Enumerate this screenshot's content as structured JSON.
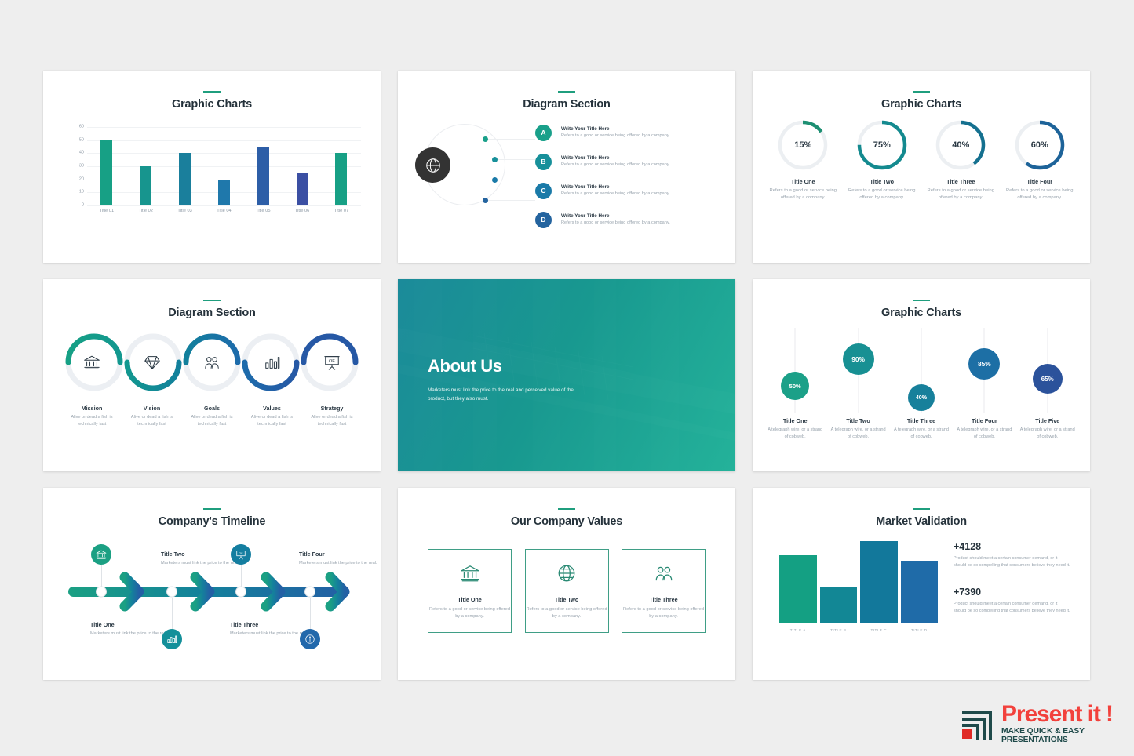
{
  "theme": {
    "accent_teal": "#1f9e7e",
    "accent_blue": "#2b5ea8",
    "title_color": "#25323b",
    "body_color": "#98a3ad"
  },
  "slides": {
    "bar_chart": {
      "title": "Graphic Charts",
      "chart_data": {
        "type": "bar",
        "title": "Graphic Charts",
        "xlabel": "",
        "ylabel": "",
        "ylim": [
          0,
          60
        ],
        "grid": true,
        "legend": "none",
        "categories": [
          "Title 01",
          "Title 02",
          "Title 03",
          "Title 04",
          "Title 05",
          "Title 06",
          "Title 07"
        ],
        "values": [
          50,
          30,
          40,
          19,
          45,
          25,
          40
        ],
        "yticks": [
          "60",
          "50",
          "40",
          "30",
          "20",
          "10",
          "0"
        ],
        "colors": [
          "#17a085",
          "#17958e",
          "#1a7f9c",
          "#1f78ab",
          "#2d5ea7",
          "#3b4fa3",
          "#17a085"
        ]
      }
    },
    "orbit_diagram": {
      "title": "Diagram Section",
      "center_icon": "globe-icon",
      "items": [
        {
          "badge": "A",
          "title": "Write Your Title Here",
          "desc": "Refers to a good or service being offered by a company.",
          "color": "#19a08a"
        },
        {
          "badge": "B",
          "title": "Write Your Title Here",
          "desc": "Refers to a good or service being offered by a company.",
          "color": "#17909a"
        },
        {
          "badge": "C",
          "title": "Write Your Title Here",
          "desc": "Refers to a good or service being offered by a company.",
          "color": "#1a7aa8"
        },
        {
          "badge": "D",
          "title": "Write Your Title Here",
          "desc": "Refers to a good or service being offered by a company.",
          "color": "#24649f"
        }
      ]
    },
    "donut_charts": {
      "title": "Graphic Charts",
      "chart_data": {
        "type": "pie",
        "title": "Graphic Charts",
        "legend": "below",
        "categories": [
          "Title One",
          "Title Two",
          "Title Three",
          "Title Four"
        ],
        "values": [
          15,
          75,
          40,
          60
        ],
        "unit": "%",
        "colors": [
          "#1d8f72",
          "#148a8f",
          "#14708f",
          "#1d6399"
        ]
      },
      "items": [
        {
          "percent": "15%",
          "title": "Title One",
          "desc": "Refers to a good or service being offered by a company."
        },
        {
          "percent": "75%",
          "title": "Title Two",
          "desc": "Refers to a good or service being offered by a company."
        },
        {
          "percent": "40%",
          "title": "Title Three",
          "desc": "Refers to a good or service being offered by a company."
        },
        {
          "percent": "60%",
          "title": "Title Four",
          "desc": "Refers to a good or service being offered by a company."
        }
      ]
    },
    "wave_diagram": {
      "title": "Diagram Section",
      "items": [
        {
          "icon": "bank-icon",
          "title": "Mission",
          "desc": "Alive or dead a fish is technically fast"
        },
        {
          "icon": "diamond-icon",
          "title": "Vision",
          "desc": "Alive or dead a fish is technically fast"
        },
        {
          "icon": "people-icon",
          "title": "Goals",
          "desc": "Alive or dead a fish is technically fast"
        },
        {
          "icon": "bar-chart-icon",
          "title": "Values",
          "desc": "Alive or dead a fish is technically fast"
        },
        {
          "icon": "presentation-icon",
          "title": "Strategy",
          "desc": "Alive or dead a fish is technically fast"
        }
      ]
    },
    "about_us": {
      "heading": "About Us",
      "paragraph": "Marketers must link the price to the real and perceived value of the product, but they also must."
    },
    "bubble_chart": {
      "title": "Graphic Charts",
      "chart_data": {
        "type": "scatter",
        "title": "Graphic Charts",
        "xlabel": "",
        "ylabel": "",
        "ylim": [
          0,
          100
        ],
        "categories": [
          "Title One",
          "Title Two",
          "Title Three",
          "Title Four",
          "Title Five"
        ],
        "values": [
          50,
          90,
          40,
          85,
          65
        ],
        "unit": "%",
        "colors": [
          "#1ba088",
          "#179093",
          "#17809b",
          "#1d6fa5",
          "#2b529b"
        ]
      },
      "items": [
        {
          "percent": "50%",
          "title": "Title One",
          "desc": "A telegraph wire, or a strand of cobweb."
        },
        {
          "percent": "90%",
          "title": "Title Two",
          "desc": "A telegraph wire, or a strand of cobweb."
        },
        {
          "percent": "40%",
          "title": "Title Three",
          "desc": "A telegraph wire, or a strand of cobweb."
        },
        {
          "percent": "85%",
          "title": "Title Four",
          "desc": "A telegraph wire, or a strand of cobweb."
        },
        {
          "percent": "65%",
          "title": "Title Five",
          "desc": "A telegraph wire, or a strand of cobweb."
        }
      ]
    },
    "timeline": {
      "title": "Company's Timeline",
      "items": [
        {
          "icon": "bank-icon",
          "title": "Title One",
          "desc": "Marketers must link the price to the real.",
          "position": "icon-above"
        },
        {
          "icon": "bar-chart-icon",
          "title": "Title Two",
          "desc": "Marketers must link the price to the real.",
          "position": "icon-below"
        },
        {
          "icon": "presentation-icon",
          "title": "Title Three",
          "desc": "Marketers must link the price to the real.",
          "position": "icon-above"
        },
        {
          "icon": "info-icon",
          "title": "Title Four",
          "desc": "Marketers must link the price to the real.",
          "position": "icon-below"
        }
      ]
    },
    "company_values": {
      "title": "Our Company Values",
      "items": [
        {
          "icon": "bank-icon",
          "title": "Title One",
          "desc": "Refers to a good or service being offered by a company."
        },
        {
          "icon": "globe-icon",
          "title": "Title Two",
          "desc": "Refers to a good or service being offered by a company."
        },
        {
          "icon": "people-icon",
          "title": "Title Three",
          "desc": "Refers to a good or service being offered by a company."
        }
      ]
    },
    "market_validation": {
      "title": "Market Validation",
      "chart_data": {
        "type": "bar",
        "title": "Market Validation",
        "xlabel": "",
        "ylabel": "",
        "ylim": [
          0,
          100
        ],
        "grid": false,
        "categories": [
          "TITLE A",
          "TITLE B",
          "TITLE C",
          "TITLE D"
        ],
        "values": [
          78,
          42,
          95,
          72
        ],
        "colors": [
          "#14a083",
          "#128795",
          "#12789b",
          "#1f6ba8"
        ]
      },
      "stats": [
        {
          "number": "+4128",
          "desc": "Product should meet a certain consumer demand, or it should be so compelling that consumers believe they need it."
        },
        {
          "number": "+7390",
          "desc": "Product should meet a certain consumer demand, or it should be so compelling that consumers believe they need it."
        }
      ]
    }
  },
  "logo": {
    "main": "Present it !",
    "sub": "MAKE QUICK & EASY PRESENTATIONS",
    "main_color": "#f2413c",
    "sub_color": "#1f4a4a"
  }
}
